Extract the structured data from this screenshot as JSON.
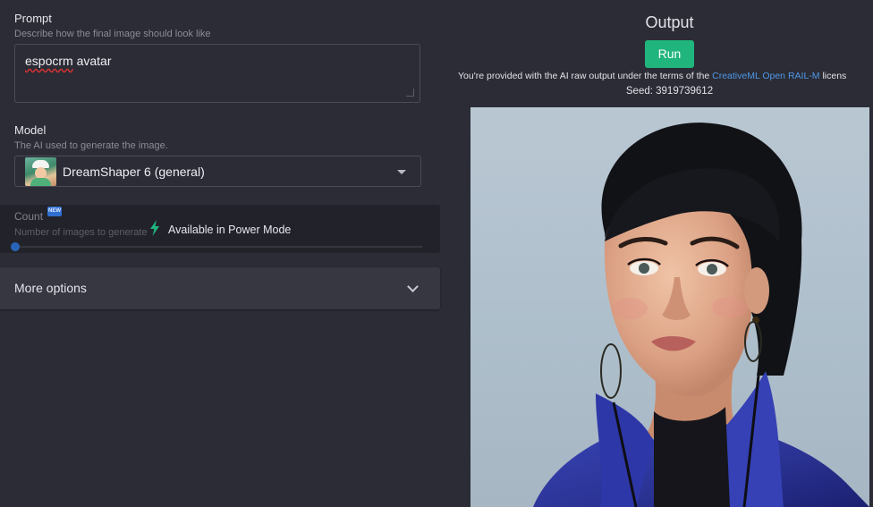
{
  "prompt": {
    "title": "Prompt",
    "description": "Describe how the final image should look like",
    "value_misspelled": "espocrm",
    "value_rest": " avatar"
  },
  "model": {
    "title": "Model",
    "description": "The AI used to generate the image.",
    "selected": "DreamShaper 6 (general)"
  },
  "count": {
    "title": "Count",
    "badge": "NEW",
    "description": "Number of images to generate",
    "power_mode": "Available in Power Mode"
  },
  "more_options": {
    "label": "More options"
  },
  "output": {
    "title": "Output",
    "run_label": "Run",
    "license_prefix": "You're provided with the AI raw output under the terms of the ",
    "license_link": "CreativeML Open RAIL-M",
    "license_suffix": " licens",
    "seed": "Seed: 3919739612"
  },
  "colors": {
    "accent_green": "#1fb57d",
    "link_blue": "#4e98e8",
    "background": "#2b2c35"
  }
}
